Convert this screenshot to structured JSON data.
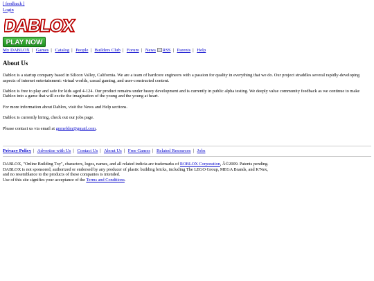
{
  "top": {
    "feedback": "[ feedback ]",
    "login": "Login"
  },
  "logo": {
    "text": "DABLOX",
    "alt": "DABLOX"
  },
  "play_button": "PLAY NOW",
  "nav": [
    "My DABLOX",
    "Games",
    "Catalog",
    "People",
    "Builders Club",
    "Forum",
    "News",
    "RSS",
    "Parents",
    "Help"
  ],
  "content": {
    "title": "About Us",
    "paragraphs": [
      "Dablox is a startup company based in Silicon Valley, California. We are a team of hardcore engineers with a passion for quality in everything that we do. Our project straddles several rapidly-developing aspects of internet entertainment: virtual worlds, casual gaming, and user-constructed content.",
      "Dablox is free to play and safe for kids aged 4-124. Our product remains under heavy development and is currently in public alpha testing. We deeply value community feedback as we continue to make Dablox into a game that will excite the imagination of the young and the young at heart.",
      "For more information about Dablox, visit the News and Help sections.",
      "Dablox is currently hiring, check out our jobs page."
    ],
    "contact_prefix": "Please contact us via email at ",
    "contact_email": "gnmefdm@gmail.com",
    "contact_suffix": "."
  },
  "footer": {
    "links": [
      "Privacy Policy",
      "Advertise with Us",
      "Contact Us",
      "About Us",
      "Free Games",
      "Related Resources",
      "Jobs"
    ],
    "legal": {
      "line1_prefix": "DABLOX, \"Online Building Toy\", characters, logos, names, and all related indicia are trademarks of ",
      "line1_link": "ROBLOX Corporation",
      "line1_suffix": ", Â©2009. Patents pending.",
      "line2": "DABLOX is not sponsored, authorized or endorsed by any producer of plastic building bricks, including The LEGO Group, MEGA Brands, and K'Nex,",
      "line3": "and no resemblance to the products of these companies is intended.",
      "line4_prefix": "Use of this site signifies your acceptance of the ",
      "line4_link": "Terms and Conditions",
      "line4_suffix": "."
    }
  }
}
